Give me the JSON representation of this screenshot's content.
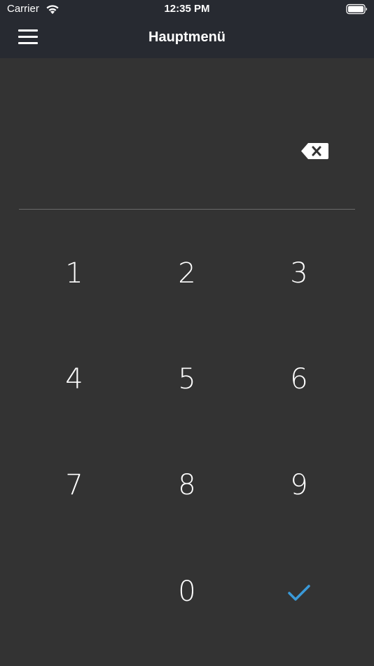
{
  "status_bar": {
    "carrier": "Carrier",
    "time": "12:35 PM"
  },
  "navbar": {
    "title": "Hauptmenü",
    "menu_icon": "hamburger-icon"
  },
  "display": {
    "value": "",
    "backspace_icon": "backspace-icon"
  },
  "keypad": {
    "keys": [
      "1",
      "2",
      "3",
      "4",
      "5",
      "6",
      "7",
      "8",
      "9",
      "0"
    ],
    "confirm_icon": "checkmark-icon"
  },
  "colors": {
    "background": "#333333",
    "topbar": "#272a31",
    "accent": "#3a9ad9"
  }
}
